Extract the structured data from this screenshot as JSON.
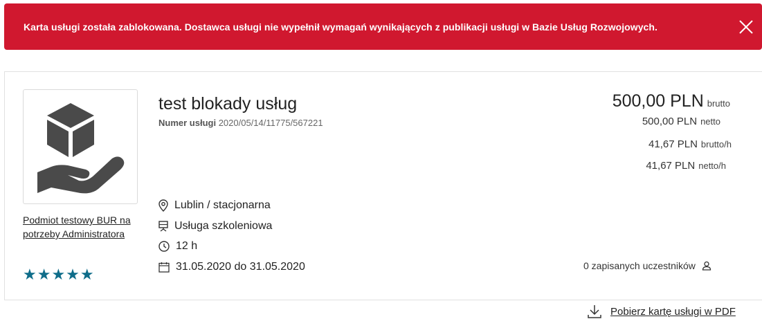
{
  "alert": {
    "message": "Karta usługi została zablokowana. Dostawca usługi nie wypełnił wymagań wynikających z publikacji usługi w Bazie Usług Rozwojowych.",
    "background_color": "#d0182f",
    "close_icon": "close-icon"
  },
  "service": {
    "title": "test blokady usług",
    "number_label": "Numer usługi",
    "number_value": "2020/05/14/11775/567221",
    "image_icon": "hand-with-box-icon",
    "provider": "Podmiot testowy BUR na potrzeby Administratora",
    "rating_stars": "★★★★★",
    "rating": 5,
    "location": "Lublin / stacjonarna",
    "type": "Usługa szkoleniowa",
    "duration": "12 h",
    "dates": "31.05.2020 do 31.05.2020"
  },
  "prices": {
    "gross": "500,00 PLN",
    "gross_label": "brutto",
    "net": "500,00 PLN",
    "net_label": "netto",
    "gross_per_hour": "41,67 PLN",
    "gross_per_hour_label": "brutto/h",
    "net_per_hour": "41,67 PLN",
    "net_per_hour_label": "netto/h"
  },
  "participants": {
    "text": "0 zapisanych uczestników"
  },
  "download": {
    "label": "Pobierz kartę usługi w PDF"
  },
  "colors": {
    "accent_stars": "#0f6d8a",
    "alert": "#d0182f"
  }
}
